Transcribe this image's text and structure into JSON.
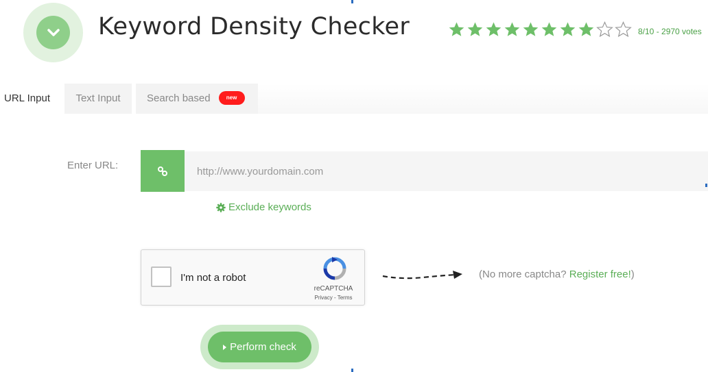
{
  "header": {
    "title": "Keyword Density Checker",
    "rating": {
      "value": 8,
      "max": 10,
      "text": "8/10 - 2970 votes"
    }
  },
  "tabs": [
    {
      "label": "URL Input",
      "active": true
    },
    {
      "label": "Text Input",
      "active": false
    },
    {
      "label": "Search based",
      "active": false,
      "badge": "new"
    }
  ],
  "form": {
    "url_label": "Enter URL:",
    "url_placeholder": "http://www.yourdomain.com",
    "url_value": "",
    "exclude_label": "Exclude keywords"
  },
  "captcha": {
    "checkbox_label": "I'm not a robot",
    "brand": "reCAPTCHA",
    "links": "Privacy - Terms"
  },
  "nocaptcha": {
    "prefix": "(No more captcha? ",
    "register": "Register free!",
    "suffix": ")"
  },
  "submit": {
    "label": "Perform check"
  },
  "colors": {
    "accent": "#6ebf69",
    "accent_light": "#cdeaca",
    "badge_red": "#ff1c1c",
    "link_green": "#5aae56"
  },
  "icons": {
    "logo": "chevron-down-icon",
    "url_box": "link-icon",
    "exclude": "gear-icon",
    "submit": "play-triangle-icon",
    "rating": "star-icon"
  }
}
